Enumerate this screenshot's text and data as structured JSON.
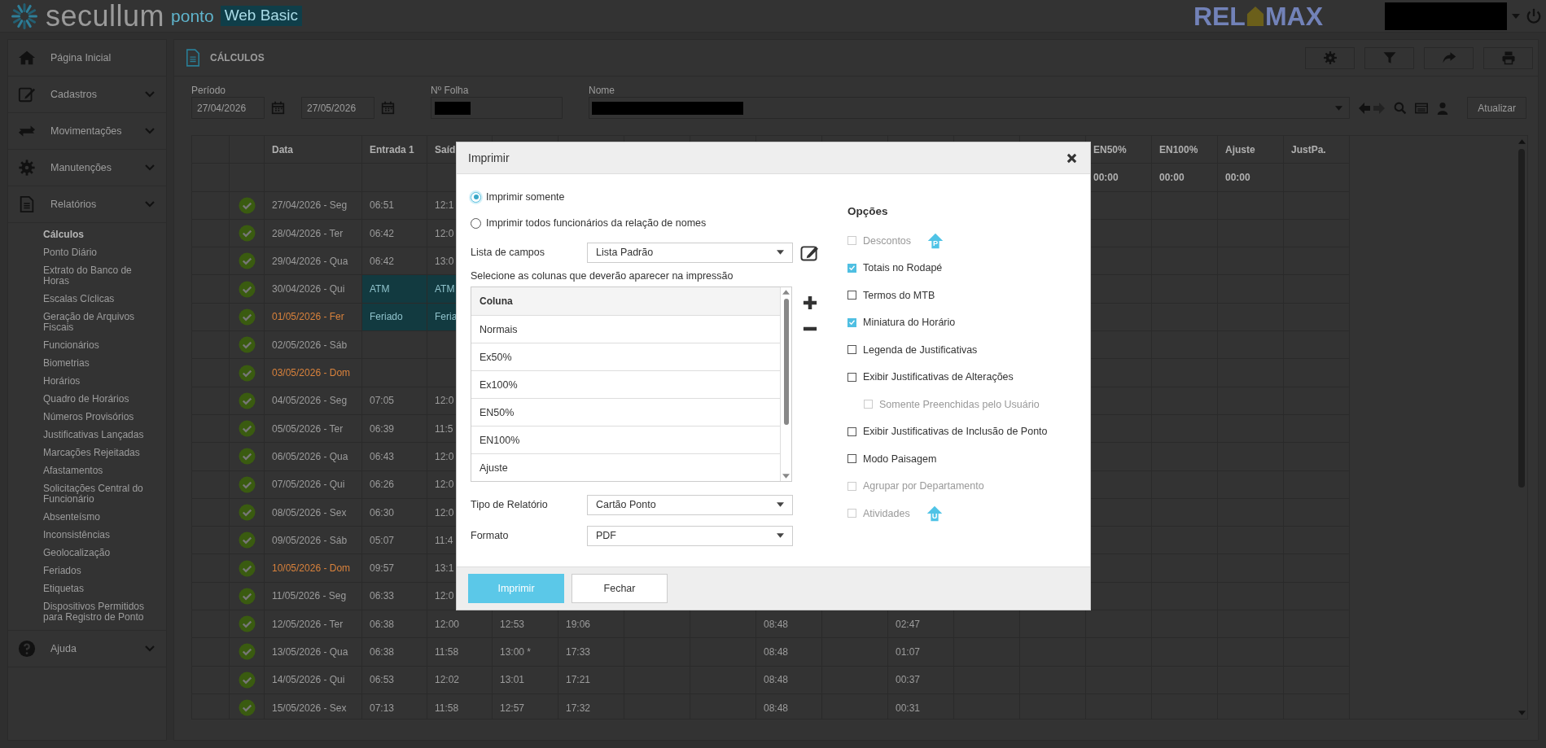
{
  "header": {
    "logo_text": "secullum",
    "logo_sub": "ponto",
    "badge": "Web Basic",
    "brand_left": "REL",
    "brand_right": "MAX"
  },
  "sidebar": {
    "items": [
      {
        "label": "Página Inicial",
        "expandable": false,
        "expanded": false
      },
      {
        "label": "Cadastros",
        "expandable": true,
        "expanded": false
      },
      {
        "label": "Movimentações",
        "expandable": true,
        "expanded": false
      },
      {
        "label": "Manutenções",
        "expandable": true,
        "expanded": false
      },
      {
        "label": "Relatórios",
        "expandable": true,
        "expanded": true,
        "children": [
          {
            "label": "Cálculos",
            "selected": true
          },
          {
            "label": "Ponto Diário",
            "selected": false
          },
          {
            "label": "Extrato do Banco de Horas",
            "selected": false
          },
          {
            "label": "Escalas Cíclicas",
            "selected": false
          },
          {
            "label": "Geração de Arquivos Fiscais",
            "selected": false
          },
          {
            "label": "Funcionários",
            "selected": false
          },
          {
            "label": "Biometrias",
            "selected": false
          },
          {
            "label": "Horários",
            "selected": false
          },
          {
            "label": "Quadro de Horários",
            "selected": false
          },
          {
            "label": "Números Provisórios",
            "selected": false
          },
          {
            "label": "Justificativas Lançadas",
            "selected": false
          },
          {
            "label": "Marcações Rejeitadas",
            "selected": false
          },
          {
            "label": "Afastamentos",
            "selected": false
          },
          {
            "label": "Solicitações Central do Funcionário",
            "selected": false
          },
          {
            "label": "Absenteísmo",
            "selected": false
          },
          {
            "label": "Inconsistências",
            "selected": false
          },
          {
            "label": "Geolocalização",
            "selected": false
          },
          {
            "label": "Feriados",
            "selected": false
          },
          {
            "label": "Etiquetas",
            "selected": false
          },
          {
            "label": "Dispositivos Permitidos para Registro de Ponto",
            "selected": false
          }
        ]
      },
      {
        "label": "Ajuda",
        "expandable": true,
        "expanded": false
      }
    ]
  },
  "panel": {
    "title": "CÁLCULOS"
  },
  "filters": {
    "period_label": "Período",
    "date_from": "27/04/2026",
    "date_to": "27/05/2026",
    "folha_label": "Nº Folha",
    "name_label": "Nome",
    "refresh_button": "Atualizar"
  },
  "table": {
    "date_label": "Data",
    "header_left": [
      "Entrada 1",
      "Saíd"
    ],
    "header_right": [
      "EN50%",
      "EN100%",
      "Ajuste",
      "JustPa."
    ],
    "totals": [
      "00:00",
      "00:00",
      "00:00"
    ],
    "rows": [
      {
        "date": "27/04/2026 - Seg",
        "holiday": false,
        "highlighted": false,
        "cells": [
          "06:51",
          "12:1"
        ]
      },
      {
        "date": "28/04/2026 - Ter",
        "holiday": false,
        "highlighted": false,
        "cells": [
          "06:42",
          "12:0"
        ]
      },
      {
        "date": "29/04/2026 - Qua",
        "holiday": false,
        "highlighted": false,
        "cells": [
          "06:42",
          "13:0"
        ]
      },
      {
        "date": "30/04/2026 - Qui",
        "holiday": false,
        "highlighted": true,
        "cells": [
          "ATM",
          "ATM"
        ]
      },
      {
        "date": "01/05/2026 - Fer",
        "holiday": true,
        "highlighted": true,
        "cells": [
          "Feriado",
          "Feria"
        ]
      },
      {
        "date": "02/05/2026 - Sáb",
        "holiday": false,
        "highlighted": false
      },
      {
        "date": "03/05/2026 - Dom",
        "holiday": true,
        "highlighted": false
      },
      {
        "date": "04/05/2026 - Seg",
        "holiday": false,
        "highlighted": false,
        "cells": [
          "07:05",
          "12:0"
        ]
      },
      {
        "date": "05/05/2026 - Ter",
        "holiday": false,
        "highlighted": false,
        "cells": [
          "06:39",
          "11:5"
        ]
      },
      {
        "date": "06/05/2026 - Qua",
        "holiday": false,
        "highlighted": false,
        "cells": [
          "06:43",
          "12:0"
        ]
      },
      {
        "date": "07/05/2026 - Qui",
        "holiday": false,
        "highlighted": false,
        "cells": [
          "06:26",
          "12:0"
        ]
      },
      {
        "date": "08/05/2026 - Sex",
        "holiday": false,
        "highlighted": false,
        "cells": [
          "06:30",
          "12:0"
        ]
      },
      {
        "date": "09/05/2026 - Sáb",
        "holiday": false,
        "highlighted": false,
        "cells": [
          "05:07",
          "11:4"
        ]
      },
      {
        "date": "10/05/2026 - Dom",
        "holiday": true,
        "highlighted": false,
        "cells": [
          "09:57",
          "13:1"
        ]
      },
      {
        "date": "11/05/2026 - Seg",
        "holiday": false,
        "highlighted": false,
        "cells": [
          "06:33",
          "12:0"
        ]
      },
      {
        "date": "12/05/2026 - Ter",
        "holiday": false,
        "highlighted": false,
        "cells": [
          "06:38",
          "12:00",
          "12:53",
          "19:06",
          null,
          null,
          "08:48",
          null,
          "02:47"
        ]
      },
      {
        "date": "13/05/2026 - Qua",
        "holiday": false,
        "highlighted": false,
        "cells": [
          "06:38",
          "11:58",
          "13:00 *",
          "17:33",
          null,
          null,
          "08:48",
          null,
          "01:07"
        ]
      },
      {
        "date": "14/05/2026 - Qui",
        "holiday": false,
        "highlighted": false,
        "cells": [
          "06:53",
          "12:02",
          "13:01",
          "17:21",
          null,
          null,
          "08:48",
          null,
          "00:37"
        ]
      },
      {
        "date": "15/05/2026 - Sex",
        "holiday": false,
        "highlighted": false,
        "cells": [
          "07:13",
          "11:58",
          "12:57",
          "17:32",
          null,
          null,
          "08:48",
          null,
          "00:31"
        ]
      }
    ]
  },
  "dialog": {
    "title": "Imprimir",
    "scope_options": [
      {
        "label": "Imprimir somente",
        "selected": true
      },
      {
        "label": "Imprimir todos funcionários da relação de nomes",
        "selected": false
      }
    ],
    "field_list": {
      "label": "Lista de campos",
      "value": "Lista Padrão"
    },
    "columns_hint": "Selecione as colunas que deverão aparecer na impressão",
    "column_list": {
      "header": "Coluna",
      "items": [
        "Normais",
        "Ex50%",
        "Ex100%",
        "EN50%",
        "EN100%",
        "Ajuste"
      ]
    },
    "report_type": {
      "label": "Tipo de Relatório",
      "value": "Cartão Ponto"
    },
    "format": {
      "label": "Formato",
      "value": "PDF"
    },
    "options_title": "Opções",
    "options": [
      {
        "label": "Descontos",
        "checked": false,
        "disabled": true,
        "badge": "P"
      },
      {
        "label": "Totais no Rodapé",
        "checked": true,
        "disabled": false
      },
      {
        "label": "Termos do MTB",
        "checked": false,
        "disabled": false
      },
      {
        "label": "Miniatura do Horário",
        "checked": true,
        "disabled": false
      },
      {
        "label": "Legenda de Justificativas",
        "checked": false,
        "disabled": false
      },
      {
        "label": "Exibir Justificativas de Alterações",
        "checked": false,
        "disabled": false,
        "children": [
          {
            "label": "Somente Preenchidas pelo Usuário",
            "checked": false,
            "disabled": true
          }
        ]
      },
      {
        "label": "Exibir Justificativas de Inclusão de Ponto",
        "checked": false,
        "disabled": false
      },
      {
        "label": "Modo Paisagem",
        "checked": false,
        "disabled": false
      },
      {
        "label": "Agrupar por Departamento",
        "checked": false,
        "disabled": true
      },
      {
        "label": "Atividades",
        "checked": false,
        "disabled": true,
        "badge": "U"
      }
    ],
    "buttons": [
      {
        "label": "Imprimir",
        "kind": "primary"
      },
      {
        "label": "Fechar",
        "kind": "secondary"
      }
    ]
  }
}
